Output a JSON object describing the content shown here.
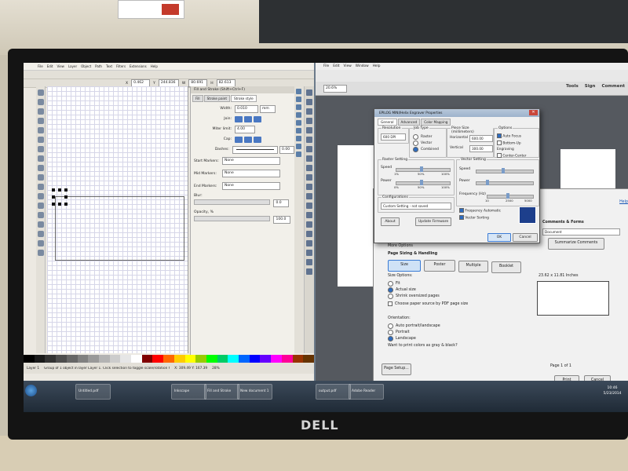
{
  "scene": {
    "monitor_brand": "DELL"
  },
  "inkscape": {
    "menu": [
      "File",
      "Edit",
      "View",
      "Layer",
      "Object",
      "Path",
      "Text",
      "Filters",
      "Extensions",
      "Help"
    ],
    "toolbar": {
      "x": "0.462",
      "y": "244.836",
      "w": "80.691",
      "h": "82.613"
    },
    "fill_stroke": {
      "title": "Fill and Stroke (Shift+Ctrl+F)",
      "tabs": [
        "Fill",
        "Stroke paint",
        "Stroke style"
      ],
      "width_label": "Width:",
      "width_value": "0.010",
      "width_unit": "mm",
      "join_label": "Join:",
      "miter_label": "Miter limit:",
      "miter_value": "4.00",
      "cap_label": "Cap:",
      "dashes_label": "Dashes:",
      "dashes_value": "0.00",
      "start_markers_label": "Start Markers:",
      "start_markers_value": "None",
      "mid_markers_label": "Mid Markers:",
      "mid_markers_value": "None",
      "end_markers_label": "End Markers:",
      "end_markers_value": "None",
      "blur_label": "Blur:",
      "blur_value": "0.0",
      "opacity_label": "Opacity, %",
      "opacity_value": "100.0"
    },
    "status": {
      "layer": "Layer 1",
      "message": "Group of 1 object in layer Layer 1. Click selection to toggle scale/rotation handles.",
      "coords": "X: 309.49  Y: 167.39",
      "zoom": "28%"
    },
    "palette": [
      "#000000",
      "#1a1a1a",
      "#333333",
      "#4d4d4d",
      "#666666",
      "#808080",
      "#999999",
      "#b3b3b3",
      "#cccccc",
      "#e6e6e6",
      "#ffffff",
      "#800000",
      "#ff0000",
      "#ff6600",
      "#ffcc00",
      "#ffff00",
      "#99cc00",
      "#00ff00",
      "#00cc66",
      "#00ffff",
      "#0066ff",
      "#0000ff",
      "#6600ff",
      "#ff00ff",
      "#ff0099",
      "#993300",
      "#663300"
    ]
  },
  "acrobat": {
    "menu": [
      "File",
      "Edit",
      "View",
      "Window",
      "Help"
    ],
    "zoom": "20.6%",
    "links": [
      "Tools",
      "Sign",
      "Comment"
    ]
  },
  "print_dialog": {
    "help": "Help",
    "comments_forms": "Comments & Forms",
    "document_value": "Document",
    "summarize": "Summarize Comments",
    "more_options": "More Options",
    "sizing_title": "Page Sizing & Handling",
    "size_btn": "Size",
    "poster_btn": "Poster",
    "multiple_btn": "Multiple",
    "booklet_btn": "Booklet",
    "size_options": "Size Options:",
    "fit": "Fit",
    "actual_size": "Actual size",
    "shrink": "Shrink oversized pages",
    "choose_paper": "Choose paper source by PDF page size",
    "dimensions": "23.62 x 11.81 Inches",
    "orientation": "Orientation:",
    "auto": "Auto portrait/landscape",
    "portrait": "Portrait",
    "landscape": "Landscape",
    "gray": "Want to print colors as gray & black?",
    "page_of": "Page 1 of 1",
    "page_setup": "Page Setup...",
    "print": "Print",
    "cancel": "Cancel"
  },
  "epilog": {
    "title": "EPILOG MINI/Helix Engraver Properties",
    "tabs": [
      "General",
      "Advanced",
      "Color Mapping"
    ],
    "resolution_label": "Resolution",
    "resolution_value": "600 DPI",
    "job_type_label": "Job Type",
    "raster": "Raster",
    "vector": "Vector",
    "combined": "Combined",
    "piece_size_label": "Piece Size (millimeters)",
    "horizontal_label": "Horizontal",
    "horizontal_value": "600.00",
    "vertical_label": "Vertical",
    "vertical_value": "300.00",
    "options_label": "Options",
    "auto_focus": "Auto Focus",
    "bottom_up": "Bottom-Up Engraving",
    "center_engraving": "Center-Center",
    "raster_setting": "Raster Setting",
    "vector_setting": "Vector Setting",
    "speed": "Speed",
    "power": "Power",
    "frequency": "Frequency (Hz)",
    "scale_1": "1%",
    "scale_50": "50%",
    "scale_100": "100%",
    "scale_0": "0%",
    "scale_0b": "0%",
    "scale_50b": "50%",
    "scale_100b": "100%",
    "freq_10": "10",
    "freq_2500": "2500",
    "freq_5000": "5000",
    "configurations": "Configurations",
    "config_value": "Custom Setting - not saved",
    "freq_auto": "Frequency Automatic",
    "vector_sorting": "Vector Sorting",
    "about": "About",
    "update_firmware": "Update Firmware",
    "ok": "OK",
    "cancel": "Cancel"
  },
  "taskbar": {
    "items": [
      "Untitled.pdf",
      "Inkscape",
      "Fill and Stroke",
      "New document 1",
      "output.pdf",
      "Adobe Reader"
    ],
    "clock_time": "10:46",
    "clock_date": "5/23/2014"
  }
}
